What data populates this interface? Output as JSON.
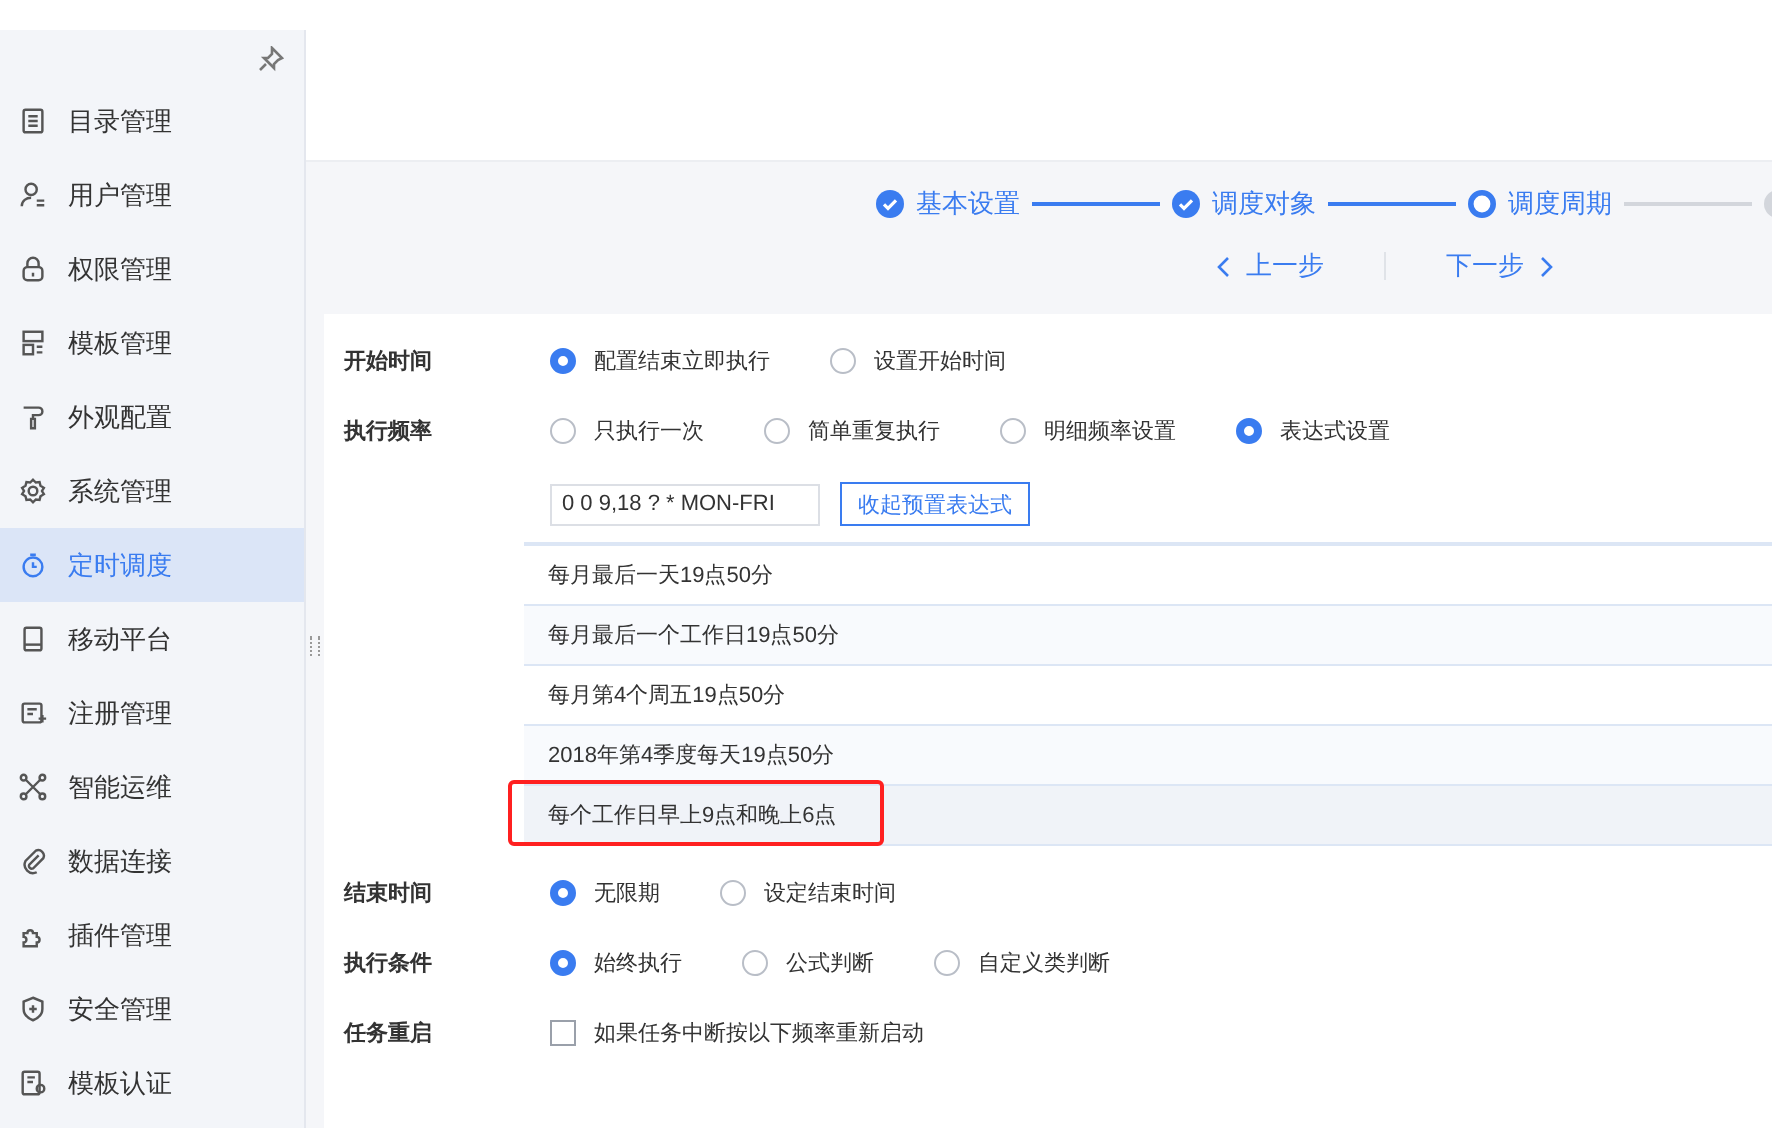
{
  "sidebar": {
    "items": [
      {
        "label": "目录管理",
        "selected": false
      },
      {
        "label": "用户管理",
        "selected": false
      },
      {
        "label": "权限管理",
        "selected": false
      },
      {
        "label": "模板管理",
        "selected": false
      },
      {
        "label": "外观配置",
        "selected": false
      },
      {
        "label": "系统管理",
        "selected": false
      },
      {
        "label": "定时调度",
        "selected": true
      },
      {
        "label": "移动平台",
        "selected": false
      },
      {
        "label": "注册管理",
        "selected": false
      },
      {
        "label": "智能运维",
        "selected": false
      },
      {
        "label": "数据连接",
        "selected": false
      },
      {
        "label": "插件管理",
        "selected": false
      },
      {
        "label": "安全管理",
        "selected": false
      },
      {
        "label": "模板认证",
        "selected": false
      }
    ]
  },
  "steps": [
    {
      "label": "基本设置",
      "completed": true,
      "current": false
    },
    {
      "label": "调度对象",
      "completed": true,
      "current": false
    },
    {
      "label": "调度周期",
      "completed": false,
      "current": true
    },
    {
      "completed": false,
      "current": false
    }
  ],
  "nav": {
    "prev": "上一步",
    "next": "下一步"
  },
  "form": [
    {
      "kind": "radio",
      "label": "开始时间",
      "options": [
        {
          "label": "配置结束立即执行",
          "selected": true
        },
        {
          "label": "设置开始时间",
          "selected": false
        }
      ]
    },
    {
      "kind": "radio",
      "label": "执行频率",
      "options": [
        {
          "label": "只执行一次",
          "selected": false
        },
        {
          "label": "简单重复执行",
          "selected": false
        },
        {
          "label": "明细频率设置",
          "selected": false
        },
        {
          "label": "表达式设置",
          "selected": true
        }
      ]
    },
    {
      "kind": "expression",
      "value": "0 0 9,18 ? * MON-FRI",
      "button": "收起预置表达式",
      "presets": [
        {
          "label": "每月最后一天19点50分",
          "selected": false
        },
        {
          "label": "每月最后一个工作日19点50分",
          "selected": false
        },
        {
          "label": "每月第4个周五19点50分",
          "selected": false
        },
        {
          "label": "2018年第4季度每天19点50分",
          "selected": false
        },
        {
          "label": "每个工作日早上9点和晚上6点",
          "selected": true
        }
      ]
    },
    {
      "kind": "radio",
      "label": "结束时间",
      "options": [
        {
          "label": "无限期",
          "selected": true
        },
        {
          "label": "设定结束时间",
          "selected": false
        }
      ]
    },
    {
      "kind": "radio",
      "label": "执行条件",
      "options": [
        {
          "label": "始终执行",
          "selected": true
        },
        {
          "label": "公式判断",
          "selected": false
        },
        {
          "label": "自定义类判断",
          "selected": false
        }
      ]
    },
    {
      "kind": "checkbox",
      "label": "任务重启",
      "text": "如果任务中断按以下频率重新启动",
      "checked": false
    }
  ]
}
